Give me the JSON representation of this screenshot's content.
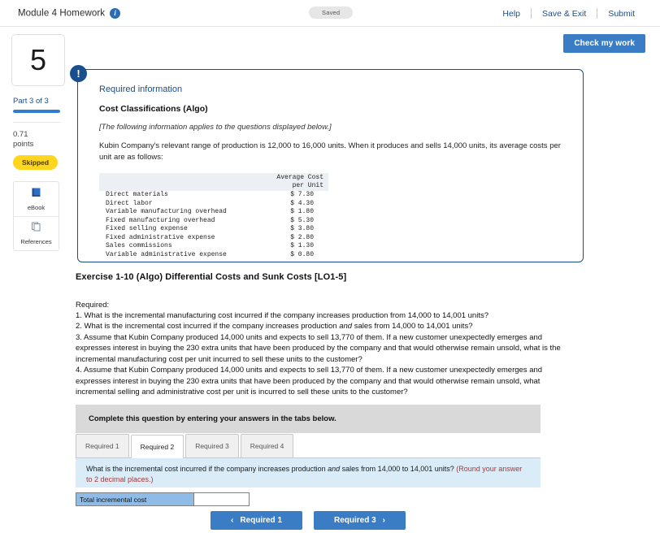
{
  "topbar": {
    "title": "Module 4 Homework",
    "info_icon": "info-icon",
    "status_pill": "Saved",
    "help": "Help",
    "save_exit": "Save & Exit",
    "submit": "Submit"
  },
  "check_work": {
    "label": "Check my work"
  },
  "sidebar": {
    "question_number": "5",
    "part_label": "Part 3 of 3",
    "points_value": "0.71",
    "points_unit": "points",
    "status_badge": "Skipped",
    "tools": [
      {
        "label": "eBook",
        "icon": "book-icon"
      },
      {
        "label": "References",
        "icon": "copy-icon"
      }
    ]
  },
  "required_info": {
    "alert_icon": "exclamation-icon",
    "heading": "Required information",
    "subheading": "Cost Classifications (Algo)",
    "italic_note": "[The following information applies to the questions displayed below.]",
    "body": "Kubin Company's relevant range of production is 12,000 to 16,000 units. When it produces and sells 14,000 units, its average costs per unit are as follows:",
    "table": {
      "header_line1": "Average Cost",
      "header_line2": "per Unit",
      "rows": [
        {
          "label": "Direct materials",
          "value": "$ 7.30"
        },
        {
          "label": "Direct labor",
          "value": "$ 4.30"
        },
        {
          "label": "Variable manufacturing overhead",
          "value": "$ 1.80"
        },
        {
          "label": "Fixed manufacturing overhead",
          "value": "$ 5.30"
        },
        {
          "label": "Fixed selling expense",
          "value": "$ 3.80"
        },
        {
          "label": "Fixed administrative expense",
          "value": "$ 2.80"
        },
        {
          "label": "Sales commissions",
          "value": "$ 1.30"
        },
        {
          "label": "Variable administrative expense",
          "value": "$ 0.80"
        }
      ]
    }
  },
  "exercise": {
    "title": "Exercise 1-10 (Algo) Differential Costs and Sunk Costs [LO1-5]",
    "required_label": "Required:",
    "items": [
      "1. What is the incremental manufacturing cost incurred if the company increases production from 14,000 to 14,001 units?",
      "2. What is the incremental cost incurred if the company increases production and sales from 14,000 to 14,001 units?",
      "3. Assume that Kubin Company produced 14,000 units and expects to sell 13,770 of them. If a new customer unexpectedly emerges and expresses interest in buying the 230 extra units that have been produced by the company and that would otherwise remain unsold, what is the incremental manufacturing cost per unit incurred to sell these units to the customer?",
      "4. Assume that Kubin Company produced 14,000 units and expects to sell 13,770 of them. If a new customer unexpectedly emerges and expresses interest in buying the 230 extra units that have been produced by the company and that would otherwise remain unsold, what incremental selling and administrative cost per unit is incurred to sell these units to the customer?"
    ]
  },
  "answer_area": {
    "complete_instruction": "Complete this question by entering your answers in the tabs below.",
    "tabs": [
      {
        "label": "Required 1",
        "active": false
      },
      {
        "label": "Required 2",
        "active": true
      },
      {
        "label": "Required 3",
        "active": false
      },
      {
        "label": "Required 4",
        "active": false
      }
    ],
    "question_text": "What is the incremental cost incurred if the company increases production and sales from 14,000 to 14,001 units?",
    "round_note": "(Round your answer to 2 decimal places.)",
    "answer_label": "Total incremental cost",
    "answer_value": "",
    "answer_placeholder": "",
    "prev_button": "Required 1",
    "next_button": "Required 3"
  },
  "colors": {
    "accent_blue": "#3b7dc4",
    "link_blue": "#1a4e8a",
    "panel_border": "#1a4e8a",
    "badge_yellow": "#ffd51e",
    "question_band": "#d9ecf7",
    "answer_label_blue": "#8fbce6",
    "gray_bar": "#d9d9d9",
    "round_note_red": "#a33a3a"
  }
}
